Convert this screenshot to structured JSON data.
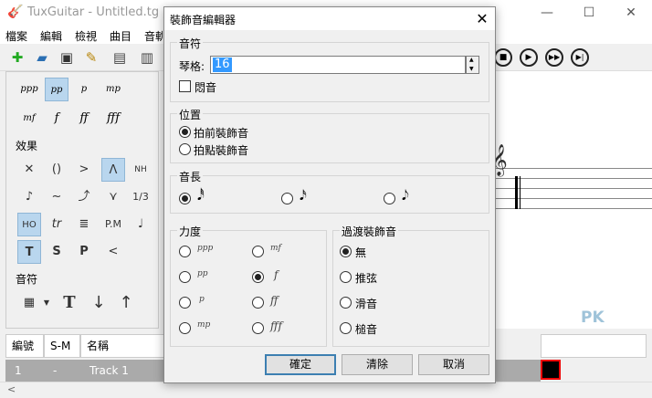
{
  "app": {
    "title": "TuxGuitar - Untitled.tg",
    "icon": "guitar-icon",
    "window_controls": [
      "—",
      "☐",
      "✕"
    ]
  },
  "menu": [
    "檔案",
    "編輯",
    "檢視",
    "曲目",
    "音軌"
  ],
  "left_panel": {
    "dynamics": [
      "ppp",
      "pp",
      "p",
      "mp",
      "mf",
      "f",
      "ff",
      "fff"
    ],
    "selected_dynamic": "pp",
    "effects_label": "效果",
    "effects": [
      "✕",
      "()",
      ">",
      "Λ",
      "NH",
      "♪",
      "~",
      "⤴",
      "⋎",
      "1/3",
      "HO",
      "tr",
      "≣",
      "P.M",
      "♩",
      "T",
      "S",
      "P",
      "<"
    ],
    "note_label": "音符"
  },
  "dialog": {
    "title": "裝飾音編輯器",
    "close": "✕",
    "note_group": {
      "label": "音符",
      "fret_label": "琴格:",
      "fret_value": "16",
      "dead_label": "悶音"
    },
    "position_group": {
      "label": "位置",
      "options": [
        "拍前裝飾音",
        "拍點裝飾音"
      ],
      "selected": 0
    },
    "duration_group": {
      "label": "音長",
      "options": [
        "𝅘𝅥𝅰",
        "𝅘𝅥𝅯",
        "𝅘𝅥𝅮"
      ],
      "selected": 0
    },
    "dynamic_group": {
      "label": "力度",
      "options": [
        "ppp",
        "mf",
        "pp",
        "f",
        "p",
        "ff",
        "mp",
        "fff"
      ],
      "selected": "f"
    },
    "transition_group": {
      "label": "過渡裝飾音",
      "options": [
        "無",
        "推弦",
        "滑音",
        "槌音"
      ],
      "selected": 0
    },
    "buttons": {
      "ok": "確定",
      "clear": "清除",
      "cancel": "取消"
    }
  },
  "track_table": {
    "headers": [
      "編號",
      "S-M",
      "名稱"
    ],
    "row": {
      "number": "1",
      "sm": "-",
      "name": "Track 1"
    }
  },
  "watermark": "PK"
}
